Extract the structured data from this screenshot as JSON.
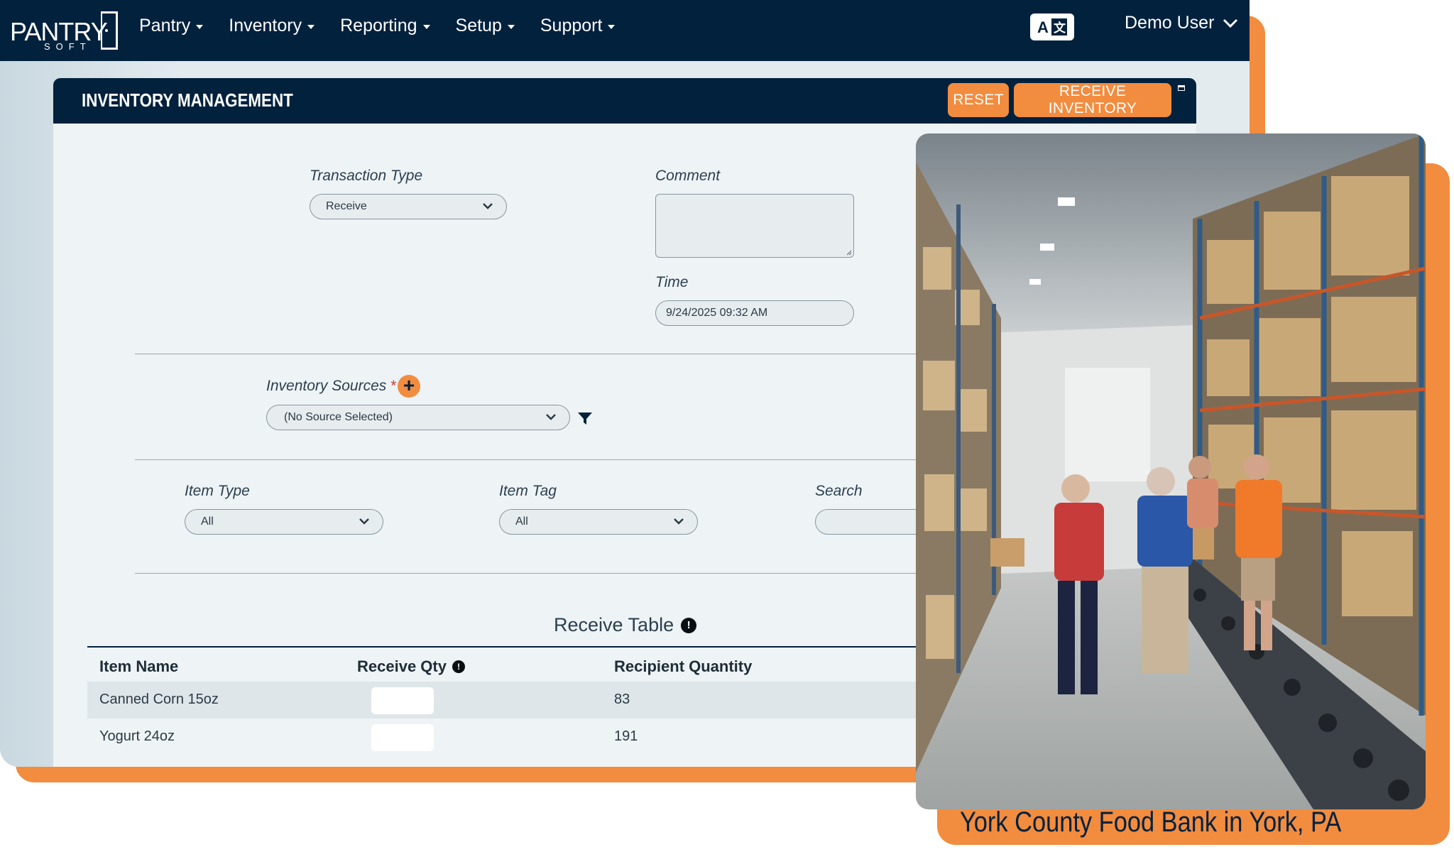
{
  "app": {
    "logo_text": "PANTRY",
    "logo_sub": "SOFT"
  },
  "nav": {
    "items": [
      {
        "label": "Pantry"
      },
      {
        "label": "Inventory"
      },
      {
        "label": "Reporting"
      },
      {
        "label": "Setup"
      },
      {
        "label": "Support"
      }
    ],
    "translate_icon": "translate-icon",
    "user_label": "Demo User"
  },
  "panel": {
    "title": "INVENTORY MANAGEMENT",
    "reset_label": "RESET",
    "receive_label": "RECEIVE INVENTORY"
  },
  "form": {
    "transaction_type_label": "Transaction Type",
    "transaction_type_value": "Receive",
    "comment_label": "Comment",
    "comment_value": "",
    "time_label": "Time",
    "time_value": "9/24/2025 09:32 AM",
    "inventory_sources_label": "Inventory Sources",
    "required_mark": "*",
    "add_symbol": "+",
    "inventory_sources_value": "(No Source Selected)",
    "item_type_label": "Item Type",
    "item_type_value": "All",
    "item_tag_label": "Item Tag",
    "item_tag_value": "All",
    "search_label": "Search",
    "search_value": ""
  },
  "table": {
    "title": "Receive Table",
    "info_symbol": "!",
    "columns": [
      "Item Name",
      "Receive Qty",
      "Recipient Quantity"
    ],
    "rows": [
      {
        "item_name": "Canned Corn 15oz",
        "receive_qty": "",
        "recipient_quantity": "83"
      },
      {
        "item_name": "Yogurt 24oz",
        "receive_qty": "",
        "recipient_quantity": "191"
      }
    ]
  },
  "photo": {
    "caption": "York County Food Bank in York, PA"
  },
  "colors": {
    "navy": "#02213d",
    "orange": "#f28c3f",
    "panel_bg": "#eef3f5"
  }
}
